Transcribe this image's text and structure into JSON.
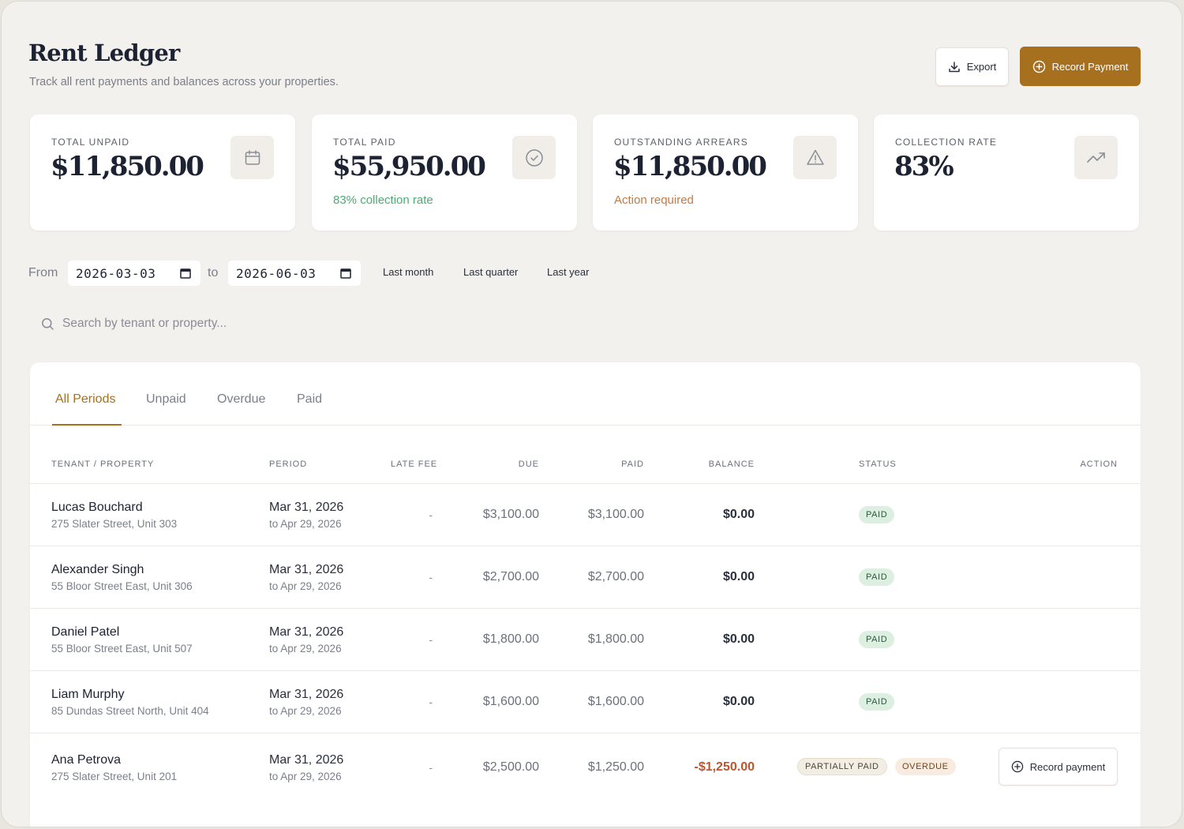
{
  "header": {
    "title": "Rent Ledger",
    "subtitle": "Track all rent payments and balances across your properties.",
    "export_label": "Export",
    "record_label": "Record Payment"
  },
  "stats": [
    {
      "label": "TOTAL UNPAID",
      "value": "$11,850.00",
      "note": "",
      "icon": "calendar-icon"
    },
    {
      "label": "TOTAL PAID",
      "value": "$55,950.00",
      "note": "83% collection rate",
      "icon": "check-circle-icon"
    },
    {
      "label": "OUTSTANDING ARREARS",
      "value": "$11,850.00",
      "note": "Action required",
      "icon": "warning-icon"
    },
    {
      "label": "COLLECTION RATE",
      "value": "83%",
      "note": "",
      "icon": "trending-up-icon"
    }
  ],
  "filters": {
    "from_label": "From",
    "from_value": "2026-03-03",
    "to_label": "to",
    "to_value": "2026-06-03",
    "quick": [
      "Last month",
      "Last quarter",
      "Last year"
    ],
    "search_placeholder": "Search by tenant or property..."
  },
  "tabs": [
    "All Periods",
    "Unpaid",
    "Overdue",
    "Paid"
  ],
  "active_tab": "All Periods",
  "columns": [
    "TENANT / PROPERTY",
    "PERIOD",
    "LATE FEE",
    "DUE",
    "PAID",
    "BALANCE",
    "STATUS",
    "ACTION"
  ],
  "rows": [
    {
      "tenant": "Lucas Bouchard",
      "property": "275 Slater Street, Unit 303",
      "period_start": "Mar 31, 2026",
      "period_end": "to Apr 29, 2026",
      "late_fee": "-",
      "due": "$3,100.00",
      "paid": "$3,100.00",
      "balance": "$0.00",
      "status": [
        "PAID"
      ],
      "action": ""
    },
    {
      "tenant": "Alexander Singh",
      "property": "55 Bloor Street East, Unit 306",
      "period_start": "Mar 31, 2026",
      "period_end": "to Apr 29, 2026",
      "late_fee": "-",
      "due": "$2,700.00",
      "paid": "$2,700.00",
      "balance": "$0.00",
      "status": [
        "PAID"
      ],
      "action": ""
    },
    {
      "tenant": "Daniel Patel",
      "property": "55 Bloor Street East, Unit 507",
      "period_start": "Mar 31, 2026",
      "period_end": "to Apr 29, 2026",
      "late_fee": "-",
      "due": "$1,800.00",
      "paid": "$1,800.00",
      "balance": "$0.00",
      "status": [
        "PAID"
      ],
      "action": ""
    },
    {
      "tenant": "Liam Murphy",
      "property": "85 Dundas Street North, Unit 404",
      "period_start": "Mar 31, 2026",
      "period_end": "to Apr 29, 2026",
      "late_fee": "-",
      "due": "$1,600.00",
      "paid": "$1,600.00",
      "balance": "$0.00",
      "status": [
        "PAID"
      ],
      "action": ""
    },
    {
      "tenant": "Ana Petrova",
      "property": "275 Slater Street, Unit 201",
      "period_start": "Mar 31, 2026",
      "period_end": "to Apr 29, 2026",
      "late_fee": "-",
      "due": "$2,500.00",
      "paid": "$1,250.00",
      "balance": "-$1,250.00",
      "status": [
        "PARTIALLY PAID",
        "OVERDUE"
      ],
      "action": "Record payment"
    }
  ],
  "colors": {
    "accent": "#a6701f",
    "paid_badge": "#dcefe1",
    "negative_balance": "#c0542d",
    "note_green": "#4cac72",
    "note_orange": "#c17a42"
  }
}
